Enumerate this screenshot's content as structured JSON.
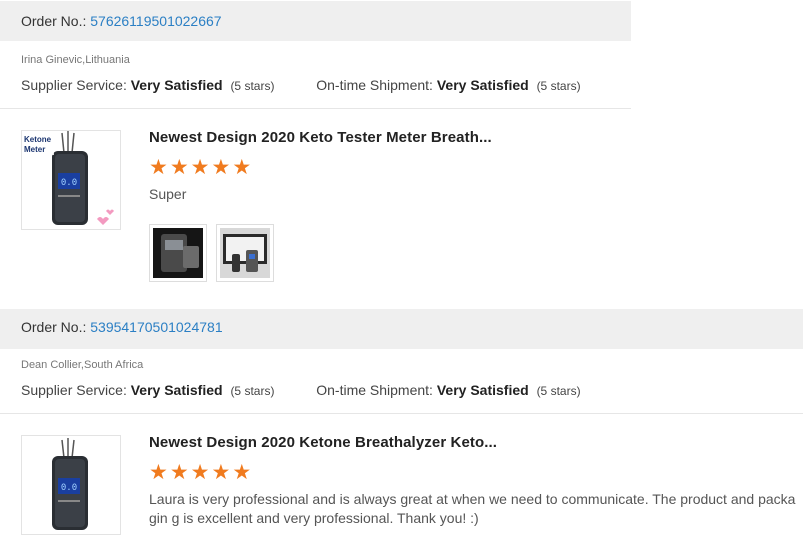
{
  "reviews": [
    {
      "order_label": "Order No.:",
      "order_number": "57626119501022667",
      "buyer": "Irina Ginevic,Lithuania",
      "supplier_service_label": "Supplier Service:",
      "supplier_service_value": "Very Satisfied",
      "supplier_service_stars": "(5 stars)",
      "shipment_label": "On-time Shipment:",
      "shipment_value": "Very Satisfied",
      "shipment_stars": "(5 stars)",
      "product_title": "Newest Design 2020 Keto Tester Meter Breath...",
      "product_thumb_text": "Ketone Meter",
      "rating": 5,
      "comment": "Super",
      "photos": [
        "photo-1",
        "photo-2"
      ]
    },
    {
      "order_label": "Order No.:",
      "order_number": "53954170501024781",
      "buyer": "Dean Collier,South Africa",
      "supplier_service_label": "Supplier Service:",
      "supplier_service_value": "Very Satisfied",
      "supplier_service_stars": "(5 stars)",
      "shipment_label": "On-time Shipment:",
      "shipment_value": "Very Satisfied",
      "shipment_stars": "(5 stars)",
      "product_title": "Newest Design 2020 Ketone Breathalyzer Keto...",
      "rating": 5,
      "comment": "Laura is very professional and is always great at when we need to communicate. The product and packagin g is excellent and very professional. Thank you! :)"
    }
  ],
  "colors": {
    "order_link": "#2b7fc4",
    "star": "#f07b1f",
    "bar_bg": "#efefef"
  }
}
